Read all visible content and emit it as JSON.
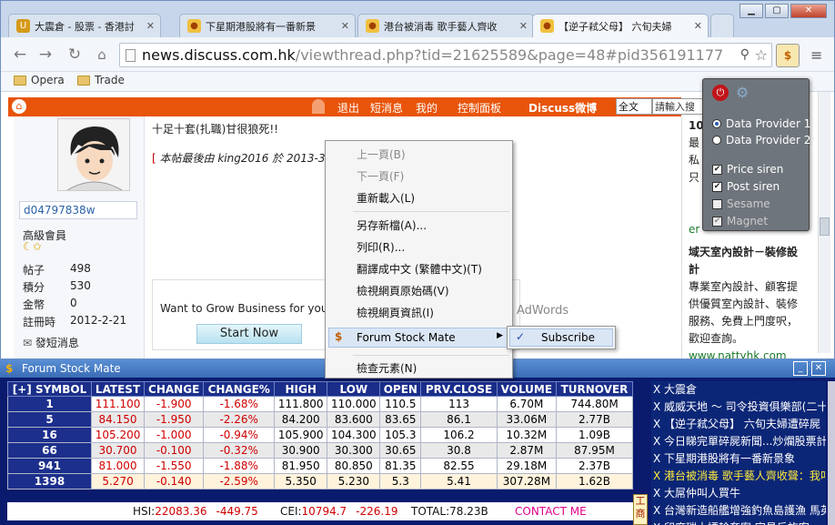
{
  "tabs": [
    {
      "title": "大震倉 - 股票 - 香港討論",
      "icon": "discuss-tab-icon"
    },
    {
      "title": "下星期港股將有一番新景",
      "icon": "discuss-tab-icon"
    },
    {
      "title": "港台被消毒 歌手藝人齊收",
      "icon": "discuss-tab-icon"
    },
    {
      "title": "【逆子弒父母】 六旬夫婦",
      "icon": "discuss-tab-icon"
    }
  ],
  "address": {
    "host": "news.discuss.com.hk",
    "path": "/viewthread.php?tid=21625589&page=48#pid356191177"
  },
  "bookmarks": [
    "Opera",
    "Trade"
  ],
  "site_nav": [
    "退出",
    "短消息",
    "我的",
    "控制面板",
    "Discuss微博",
    "全文",
    "請輸入搜"
  ],
  "user": {
    "name": "d04797838w",
    "rank": "高級會員",
    "stats": [
      {
        "label": "帖子",
        "value": "498"
      },
      {
        "label": "積分",
        "value": "530"
      },
      {
        "label": "金幣",
        "value": "0"
      },
      {
        "label": "註冊時",
        "value": "2012-2-21"
      }
    ],
    "msg_link": "發短消息"
  },
  "post": {
    "line1": "十足十套(扎職)甘很狼死!!",
    "edit_prefix": "[ ",
    "edit_note": "本帖最後由 king2016 於 2013-3"
  },
  "ad": {
    "text": "Want to Grow Business for your W",
    "button": "Start Now",
    "brand": "AdWords"
  },
  "right_col": {
    "lines": [
      "10",
      "最",
      "私",
      "只",
      "",
      "",
      "er"
    ],
    "heading": "域天室內設計－裝修設計",
    "body": "專業室內設計、顧客提供優質室內設計、裝修服務、免費上門度呎，歡迎查詢。",
    "link": "www.nattyhk.com"
  },
  "context_menu": [
    {
      "label": "上一頁(B)",
      "disabled": true
    },
    {
      "label": "下一頁(F)",
      "disabled": true
    },
    {
      "label": "重新載入(L)",
      "disabled": false
    },
    {
      "label": "另存新檔(A)...",
      "disabled": false
    },
    {
      "label": "列印(R)...",
      "disabled": false
    },
    {
      "label": "翻譯成中文 (繁體中文)(T)",
      "disabled": false
    },
    {
      "label": "檢視網頁原始碼(V)",
      "disabled": false
    },
    {
      "label": "檢視網頁資訊(I)",
      "disabled": false
    },
    {
      "label": "Forum Stock Mate",
      "disabled": false
    },
    {
      "label": "檢查元素(N)",
      "disabled": false
    }
  ],
  "submenu": {
    "label": "Subscribe",
    "checked": true
  },
  "extension_popup": {
    "radios": [
      {
        "label": "Data Provider 1",
        "checked": true
      },
      {
        "label": "Data Provider 2",
        "checked": false
      }
    ],
    "checks": [
      {
        "label": "Price siren",
        "checked": true
      },
      {
        "label": "Post siren",
        "checked": true
      },
      {
        "label": "Sesame",
        "checked": false
      },
      {
        "label": "Magnet",
        "checked": true
      }
    ]
  },
  "panel": {
    "title": "Forum Stock Mate",
    "headers": [
      "[+] SYMBOL",
      "LATEST",
      "CHANGE",
      "CHANGE%",
      "HIGH",
      "LOW",
      "OPEN",
      "PRV.CLOSE",
      "VOLUME",
      "TURNOVER"
    ],
    "rows": [
      [
        "1",
        "111.100",
        "-1.900",
        "-1.68%",
        "111.800",
        "110.000",
        "110.5",
        "113",
        "6.70M",
        "744.80M"
      ],
      [
        "5",
        "84.150",
        "-1.950",
        "-2.26%",
        "84.200",
        "83.600",
        "83.65",
        "86.1",
        "33.06M",
        "2.77B"
      ],
      [
        "16",
        "105.200",
        "-1.000",
        "-0.94%",
        "105.900",
        "104.300",
        "105.3",
        "106.2",
        "10.32M",
        "1.09B"
      ],
      [
        "66",
        "30.700",
        "-0.100",
        "-0.32%",
        "30.900",
        "30.300",
        "30.65",
        "30.8",
        "2.87M",
        "87.95M"
      ],
      [
        "941",
        "81.000",
        "-1.550",
        "-1.88%",
        "81.950",
        "80.850",
        "81.35",
        "82.55",
        "29.18M",
        "2.37B"
      ],
      [
        "1398",
        "5.270",
        "-0.140",
        "-2.59%",
        "5.350",
        "5.230",
        "5.3",
        "5.41",
        "307.28M",
        "1.62B"
      ]
    ],
    "footer": {
      "hsi_label": "HSI:",
      "hsi_value": "22083.36",
      "hsi_change": "-449.75",
      "cei_label": "CEI:",
      "cei_value": "10794.7",
      "cei_change": "-226.19",
      "total_label": "TOTAL:",
      "total_value": "78.23B",
      "contact": "CONTACT ME"
    },
    "side_button": "工商",
    "news": [
      "X 大震倉",
      "X 威威天地 ～ 司令投資俱樂部(二十",
      "X 【逆子弒父母】 六旬夫婦遭碎屍",
      "X 今日睇完單碎屍新聞...炒爛股票計",
      "X 下星期港股將有一番新景象",
      "X 港台被消毒 歌手藝人齊收聲：我叫",
      "X 大屌仲叫人買牛",
      "X 台灣新造船艦增強釣魚島護漁 馬英",
      "X 印度瑞士嫖輪姦案 官員斥旅客"
    ],
    "news_highlight_index": 5
  }
}
